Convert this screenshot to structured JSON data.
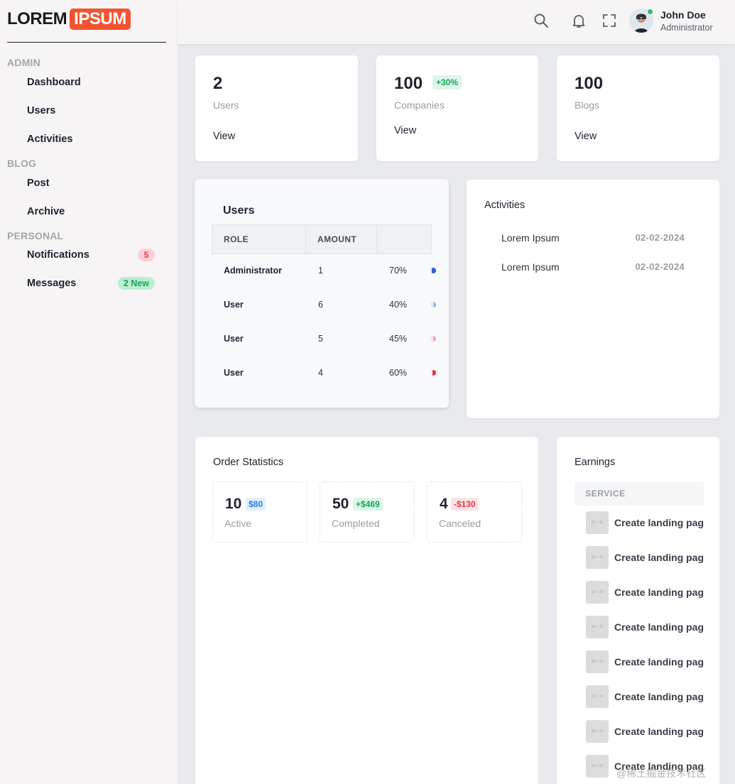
{
  "brand": {
    "part1": "LOREM",
    "part2": "IPSUM"
  },
  "sidebar": {
    "sections": [
      {
        "label": "ADMIN",
        "items": [
          {
            "label": "Dashboard"
          },
          {
            "label": "Users"
          },
          {
            "label": "Activities"
          }
        ]
      },
      {
        "label": "BLOG",
        "items": [
          {
            "label": "Post"
          },
          {
            "label": "Archive"
          }
        ]
      },
      {
        "label": "PERSONAL",
        "items": [
          {
            "label": "Notifications",
            "badge": "5"
          },
          {
            "label": "Messages",
            "badge": "2 New"
          }
        ]
      }
    ]
  },
  "header": {
    "icons": [
      "search-icon",
      "bell-icon",
      "fullscreen-icon"
    ],
    "user": {
      "name": "John Doe",
      "role": "Administrator",
      "status_color": "#23c55e"
    }
  },
  "stats": [
    {
      "value": "2",
      "label": "Users",
      "link": "View"
    },
    {
      "value": "100",
      "label": "Companies",
      "change": "+30%",
      "link": "View"
    },
    {
      "value": "100",
      "label": "Blogs",
      "link": "View"
    }
  ],
  "users_table": {
    "title": "Users",
    "columns": [
      "ROLE",
      "AMOUNT",
      ""
    ],
    "rows": [
      {
        "role": "Administrator",
        "amount": "1",
        "percent": "70%",
        "color": "#2f5fd6"
      },
      {
        "role": "User",
        "amount": "6",
        "percent": "40%",
        "color": "#86aef7"
      },
      {
        "role": "User",
        "amount": "5",
        "percent": "45%",
        "color": "#f3a8bf"
      },
      {
        "role": "User",
        "amount": "4",
        "percent": "60%",
        "color": "#e2394a"
      }
    ]
  },
  "activities": {
    "title": "Activities",
    "items": [
      {
        "name": "Lorem Ipsum",
        "date": "02-02-2024"
      },
      {
        "name": "Lorem Ipsum",
        "date": "02-02-2024"
      }
    ]
  },
  "order_statistics": {
    "title": "Order Statistics",
    "items": [
      {
        "value": "10",
        "chip": "$80",
        "label": "Active",
        "chip_bg": "#e2eefe",
        "chip_color": "#2f7be0"
      },
      {
        "value": "50",
        "chip": "+$469",
        "label": "Completed",
        "chip_bg": "#ddf6e8",
        "chip_color": "#17a35a"
      },
      {
        "value": "4",
        "chip": "-$130",
        "label": "Canceled",
        "chip_bg": "#fde3e6",
        "chip_color": "#e2394a"
      }
    ]
  },
  "earnings": {
    "title": "Earnings",
    "column": "SERVICE",
    "thumb_text": "32 × 32",
    "items": [
      "Create landing pag",
      "Create landing pag",
      "Create landing pag",
      "Create landing pag",
      "Create landing pag",
      "Create landing pag",
      "Create landing pag",
      "Create landing pag"
    ]
  },
  "watermark": "@稀土掘金技术社区"
}
